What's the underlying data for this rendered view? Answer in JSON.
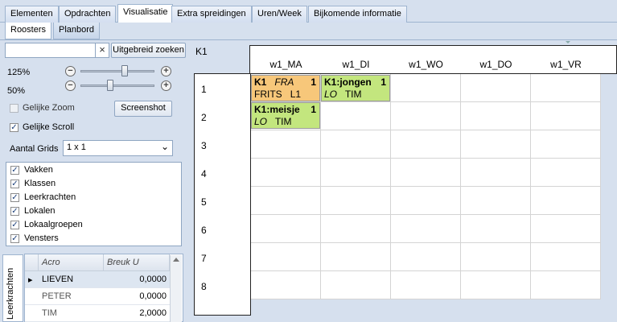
{
  "top_tabs": [
    "Elementen",
    "Opdrachten",
    "Visualisatie",
    "Extra spreidingen",
    "Uren/Week",
    "Bijkomende informatie"
  ],
  "sub_tabs": [
    "Roosters",
    "Planbord"
  ],
  "left_panel": {
    "search": {
      "value": "",
      "clear_glyph": "×",
      "advanced_label": "Uitgebreid zoeken"
    },
    "zoom1_label": "125%",
    "zoom2_label": "50%",
    "zoom1_level_fraction": 0.6,
    "zoom2_level_fraction": 0.4,
    "minus_glyph": "−",
    "plus_glyph": "+",
    "same_zoom_label": "Gelijke Zoom",
    "same_zoom_checked": false,
    "screenshot_label": "Screenshot",
    "same_scroll_label": "Gelijke Scroll",
    "same_scroll_checked": true,
    "grid_count_label": "Aantal Grids",
    "grid_count_value": "1 x 1",
    "check_glyph": "✓",
    "check_items": [
      "Vakken",
      "Klassen",
      "Leerkrachten",
      "Lokalen",
      "Lokaalgroepen",
      "Vensters"
    ]
  },
  "teacher_grid": {
    "side_tab": "Leerkrachten",
    "columns": [
      "Acro",
      "Breuk U"
    ],
    "row_pointer": "▸",
    "rows": [
      {
        "acro": "LIEVEN",
        "breuk": "0,0000"
      },
      {
        "acro": "PETER",
        "breuk": "0,0000"
      },
      {
        "acro": "TIM",
        "breuk": "2,0000"
      }
    ]
  },
  "schedule": {
    "title": "K1",
    "days": [
      "w1_MA",
      "w1_DI",
      "w1_WO",
      "w1_DO",
      "w1_VR"
    ],
    "periods": [
      "1",
      "2",
      "3",
      "4",
      "5",
      "6",
      "7",
      "8"
    ],
    "lessons": [
      {
        "line1_bold": "K1",
        "line1_italic": "FRA",
        "count": "1",
        "line2_a": "FRITS",
        "line2_b": "L1",
        "color": "#f7c77a"
      },
      {
        "line1_bold": "K1:jongen",
        "line1_italic": "",
        "count": "1",
        "line2_a": "LO",
        "line2_b": "TIM",
        "color": "#c3e67e"
      },
      {
        "line1_bold": "K1:meisje",
        "line1_italic": "",
        "count": "1",
        "line2_a": "LO",
        "line2_b": "TIM",
        "color": "#c3e67e"
      }
    ]
  }
}
